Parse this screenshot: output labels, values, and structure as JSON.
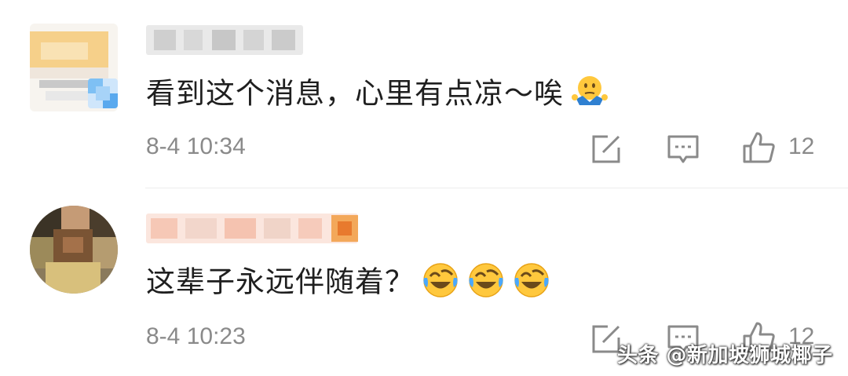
{
  "comments": [
    {
      "text": "看到这个消息，心里有点凉～唉",
      "emoji": "shrug-emoji",
      "timestamp": "8-4 10:34",
      "like_count": "12"
    },
    {
      "text": "这辈子永远伴随着？",
      "emoji": "laughing-crying-emoji",
      "timestamp": "8-4 10:23",
      "like_count": "12"
    }
  ],
  "watermark": "头条 @新加坡狮城椰子",
  "colors": {
    "text": "#1f1f1f",
    "meta": "#8a8a8a",
    "icon": "#8a8a8a",
    "divider": "#ececec",
    "emoji_face": "#ffc83d"
  },
  "icons": {
    "repost": "edit-icon",
    "reply": "comment-icon",
    "like": "thumbs-up-icon"
  }
}
